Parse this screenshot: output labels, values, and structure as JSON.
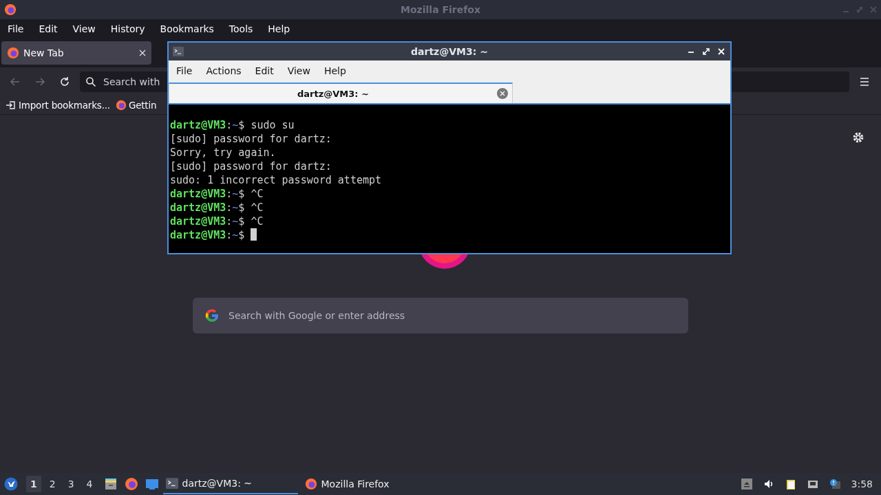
{
  "firefox": {
    "title": "Mozilla Firefox",
    "menu": [
      "File",
      "Edit",
      "View",
      "History",
      "Bookmarks",
      "Tools",
      "Help"
    ],
    "tabs": [
      {
        "label": "New Tab",
        "selected": true
      }
    ],
    "address": {
      "placeholder": "Search with"
    },
    "bookmarks": [
      {
        "label": "Import bookmarks...",
        "kind": "import"
      },
      {
        "label": "Gettin",
        "kind": "firefox"
      }
    ],
    "search": {
      "placeholder": "Search with Google or enter address"
    }
  },
  "terminal": {
    "title": "dartz@VM3: ~",
    "menu": [
      "File",
      "Actions",
      "Edit",
      "View",
      "Help"
    ],
    "tabs": [
      {
        "label": "dartz@VM3: ~",
        "selected": true
      }
    ],
    "lines": [
      {
        "kind": "prompt",
        "user": "dartz@VM3",
        "separator": ":",
        "path": "~",
        "symbol": "$",
        "command": "sudo su"
      },
      {
        "kind": "output",
        "text": "[sudo] password for dartz:"
      },
      {
        "kind": "output",
        "text": "Sorry, try again."
      },
      {
        "kind": "output",
        "text": "[sudo] password for dartz:"
      },
      {
        "kind": "output",
        "text": "sudo: 1 incorrect password attempt"
      },
      {
        "kind": "prompt",
        "user": "dartz@VM3",
        "separator": ":",
        "path": "~",
        "symbol": "$",
        "command": "^C"
      },
      {
        "kind": "prompt",
        "user": "dartz@VM3",
        "separator": ":",
        "path": "~",
        "symbol": "$",
        "command": "^C"
      },
      {
        "kind": "prompt",
        "user": "dartz@VM3",
        "separator": ":",
        "path": "~",
        "symbol": "$",
        "command": "^C"
      },
      {
        "kind": "prompt",
        "user": "dartz@VM3",
        "separator": ":",
        "path": "~",
        "symbol": "$",
        "cursor": true
      }
    ]
  },
  "taskbar": {
    "workspaces": [
      {
        "label": "1",
        "selected": true
      },
      {
        "label": "2",
        "selected": false
      },
      {
        "label": "3",
        "selected": false
      },
      {
        "label": "4",
        "selected": false
      }
    ],
    "tasks": [
      {
        "label": "dartz@VM3: ~",
        "kind": "terminal",
        "selected": true
      },
      {
        "label": "Mozilla Firefox",
        "kind": "firefox",
        "selected": false
      }
    ],
    "clock": "3:58"
  }
}
